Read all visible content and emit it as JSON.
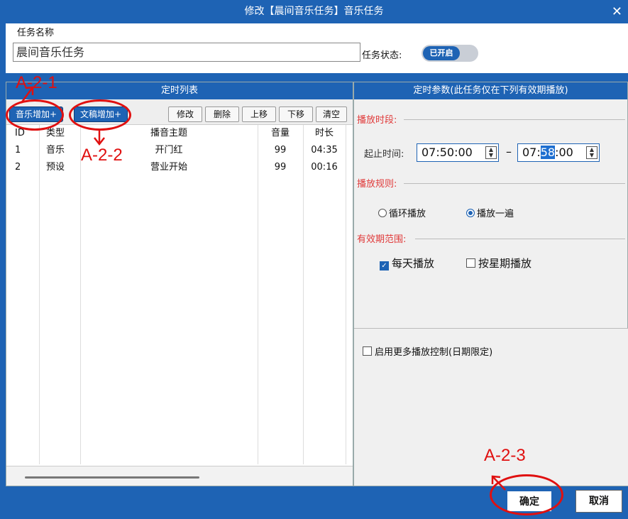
{
  "window": {
    "title": "修改【晨间音乐任务】音乐任务",
    "close_glyph": "✕"
  },
  "task": {
    "name_label": "任务名称",
    "name_value": "晨间音乐任务",
    "status_label": "任务状态:",
    "status_toggle": "已开启"
  },
  "schedule_list": {
    "header": "定时列表",
    "toolbar": {
      "music_add": "音乐增加+",
      "doc_add": "文稿增加+",
      "edit": "修改",
      "delete": "删除",
      "move_up": "上移",
      "move_down": "下移",
      "clear": "清空"
    },
    "columns": [
      "ID",
      "类型",
      "播音主题",
      "音量",
      "时长"
    ],
    "rows": [
      {
        "id": "1",
        "type": "音乐",
        "topic": "开门红",
        "volume": "99",
        "duration": "04:35"
      },
      {
        "id": "2",
        "type": "预设",
        "topic": "营业开始",
        "volume": "99",
        "duration": "00:16"
      }
    ]
  },
  "params": {
    "header": "定时参数(此任务仅在下列有效期播放)",
    "period_title": "播放时段:",
    "time_label": "起止时间:",
    "start_time": "07:50:00",
    "end_time_prefix": "07:",
    "end_time_selected": "58",
    "end_time_suffix": ":00",
    "dash": "–",
    "rule_title": "播放规则:",
    "rule_loop": "循环播放",
    "rule_once": "播放一遍",
    "rule_selected": "once",
    "validity_title": "有效期范围:",
    "daily": "每天播放",
    "daily_checked": true,
    "weekly": "按星期播放",
    "weekly_checked": false,
    "more_control": "启用更多播放控制(日期限定)",
    "more_control_checked": false
  },
  "footer": {
    "ok": "确定",
    "cancel": "取消"
  },
  "annotations": {
    "a1": "A-2-1",
    "a2": "A-2-2",
    "a3": "A-2-3",
    "color": "#e01010"
  },
  "colors": {
    "accent": "#1e63b4",
    "group_title": "#e03a3a"
  }
}
